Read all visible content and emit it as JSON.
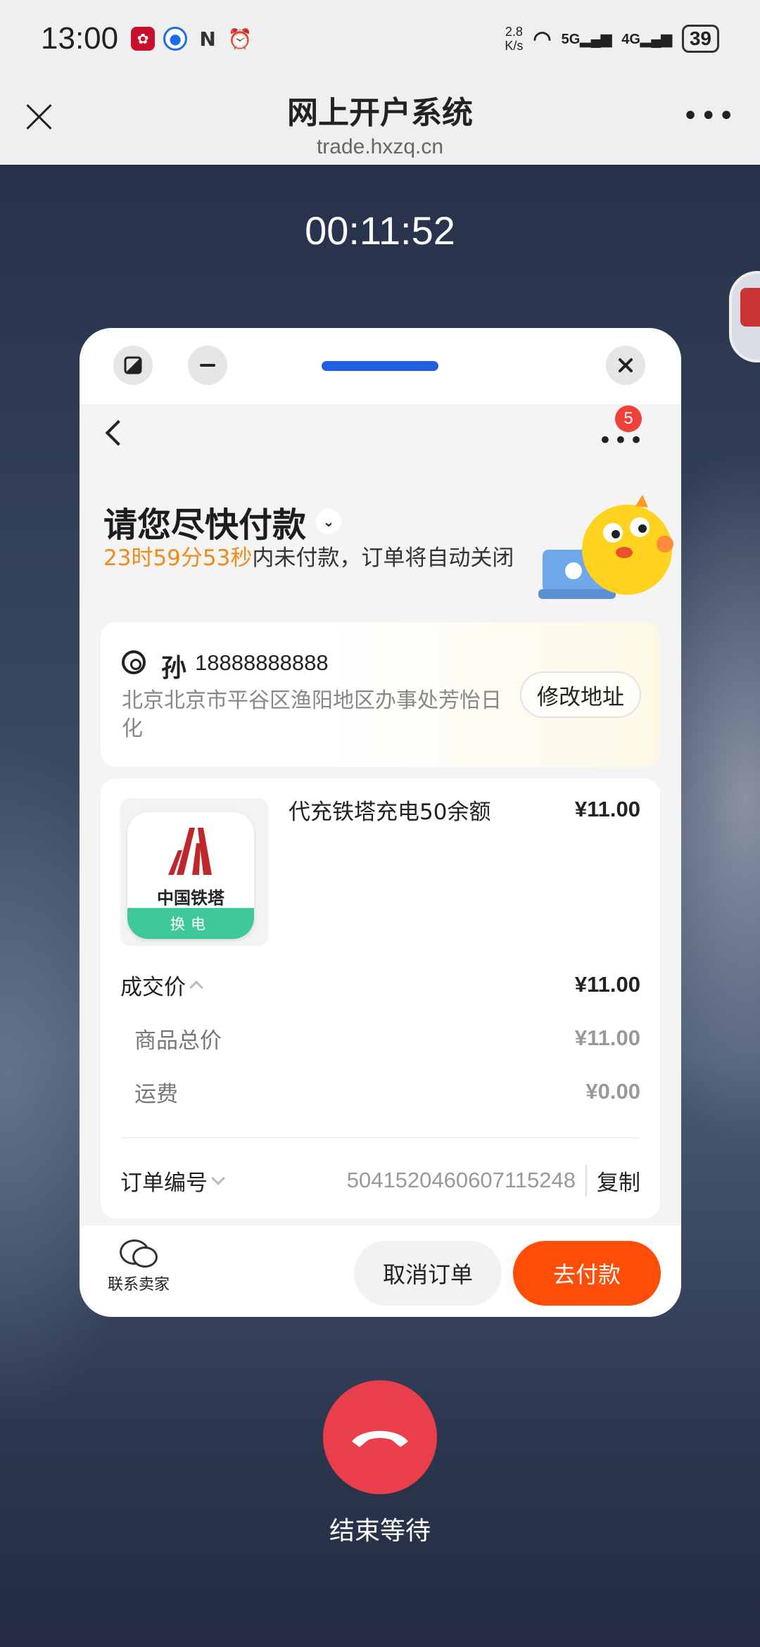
{
  "status_bar": {
    "time": "13:00",
    "net_speed_value": "2.8",
    "net_speed_unit": "K/s",
    "signal1": "5G",
    "signal2": "4G",
    "battery": "39"
  },
  "header": {
    "title": "网上开户系统",
    "url": "trade.hxzq.cn"
  },
  "call_timer": "00:11:52",
  "order": {
    "notification_count": "5",
    "title": "请您尽快付款",
    "countdown": "23时59分53秒",
    "countdown_suffix": "内未付款，订单将自动关闭",
    "address": {
      "name": "孙",
      "phone": "18888888888",
      "line": "北京北京市平谷区渔阳地区办事处芳怡日化",
      "edit_label": "修改地址"
    },
    "product": {
      "title": "代充铁塔充电50余额",
      "price": "¥11.00",
      "icon_brand": "中国铁塔",
      "icon_band": "换电"
    },
    "price_rows": {
      "deal_label": "成交价",
      "deal_value": "¥11.00",
      "goods_label": "商品总价",
      "goods_value": "¥11.00",
      "shipping_label": "运费",
      "shipping_value": "¥0.00"
    },
    "order_no_label": "订单编号",
    "order_no": "5041520460607115248",
    "copy_label": "复制",
    "contact_label": "联系卖家",
    "cancel_label": "取消订单",
    "pay_label": "去付款"
  },
  "hangup_label": "结束等待",
  "colors": {
    "pay_button": "#ff4d0a",
    "countdown": "#f08a1a",
    "hangup": "#ea3e4a",
    "drag_handle": "#1f5ee0"
  }
}
